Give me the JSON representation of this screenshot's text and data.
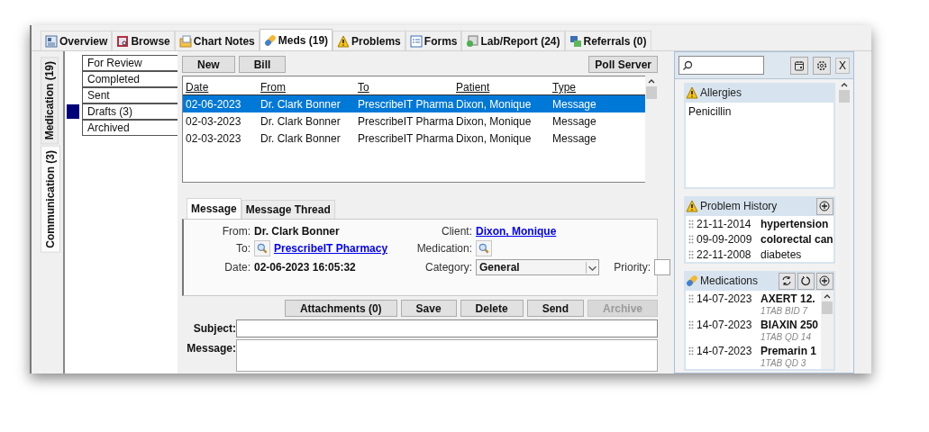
{
  "tabs": [
    {
      "label": "Overview",
      "selected": false
    },
    {
      "label": "Browse",
      "selected": false
    },
    {
      "label": "Chart Notes",
      "selected": false
    },
    {
      "label": "Meds (19)",
      "selected": true
    },
    {
      "label": "Problems",
      "selected": false
    },
    {
      "label": "Forms",
      "selected": false
    },
    {
      "label": "Lab/Report (24)",
      "selected": false
    },
    {
      "label": "Referrals (0)",
      "selected": false
    }
  ],
  "side_tabs": [
    {
      "label": "Medication (19)",
      "selected": false
    },
    {
      "label": "Communication (3)",
      "selected": true
    }
  ],
  "folders": [
    {
      "label": "For Review",
      "selected": false
    },
    {
      "label": "Completed",
      "selected": false
    },
    {
      "label": "Sent",
      "selected": false
    },
    {
      "label": "Drafts (3)",
      "selected": true
    },
    {
      "label": "Archived",
      "selected": false
    }
  ],
  "toolbar": {
    "buttons": [
      "New",
      "Bill"
    ],
    "poll_button": "Poll Server"
  },
  "table": {
    "columns": [
      "Date",
      "From",
      "To",
      "Patient",
      "Type"
    ],
    "rows": [
      {
        "cells": [
          "02-06-2023",
          "Dr. Clark Bonner",
          "PrescribeIT Pharma",
          "Dixon, Monique",
          "Message"
        ],
        "selected": true
      },
      {
        "cells": [
          "02-03-2023",
          "Dr. Clark Bonner",
          "PrescribeIT Pharma",
          "Dixon, Monique",
          "Message"
        ],
        "selected": false
      },
      {
        "cells": [
          "02-03-2023",
          "Dr. Clark Bonner",
          "PrescribeIT Pharma",
          "Dixon, Monique",
          "Message"
        ],
        "selected": false
      }
    ]
  },
  "detail_tabs": [
    {
      "label": "Message",
      "selected": true
    },
    {
      "label": "Message Thread",
      "selected": false
    }
  ],
  "message": {
    "from_label": "From:",
    "from": "Dr. Clark Bonner",
    "to_label": "To:",
    "to": "PrescribeIT Pharmacy",
    "date_label": "Date:",
    "date": "02-06-2023 16:05:32",
    "client_label": "Client:",
    "client": "Dixon, Monique",
    "medication_label": "Medication:",
    "category_label": "Category:",
    "category": "General",
    "priority_label": "Priority:"
  },
  "actions": [
    {
      "label": "Attachments (0)",
      "disabled": false
    },
    {
      "label": "Save",
      "disabled": false
    },
    {
      "label": "Delete",
      "disabled": false
    },
    {
      "label": "Send",
      "disabled": false
    },
    {
      "label": "Archive",
      "disabled": true
    }
  ],
  "subject_label": "Subject:",
  "message_label": "Message:",
  "right_panel": {
    "close_button": "X",
    "allergies": {
      "title": "Allergies",
      "items": [
        "Penicillin"
      ]
    },
    "problem_history": {
      "title": "Problem History",
      "items": [
        {
          "date": "21-11-2014",
          "name": "hypertension",
          "bold": true
        },
        {
          "date": "09-09-2009",
          "name": "colorectal can",
          "bold": true
        },
        {
          "date": "22-11-2008",
          "name": "diabetes",
          "bold": false
        }
      ]
    },
    "medications": {
      "title": "Medications",
      "items": [
        {
          "date": "14-07-2023",
          "name": "AXERT 12.",
          "sig": "1TAB BID 7"
        },
        {
          "date": "14-07-2023",
          "name": "BIAXIN 250",
          "sig": "1TAB QD 14"
        },
        {
          "date": "14-07-2023",
          "name": "Premarin 1",
          "sig": "1TAB QD 3"
        }
      ]
    }
  }
}
